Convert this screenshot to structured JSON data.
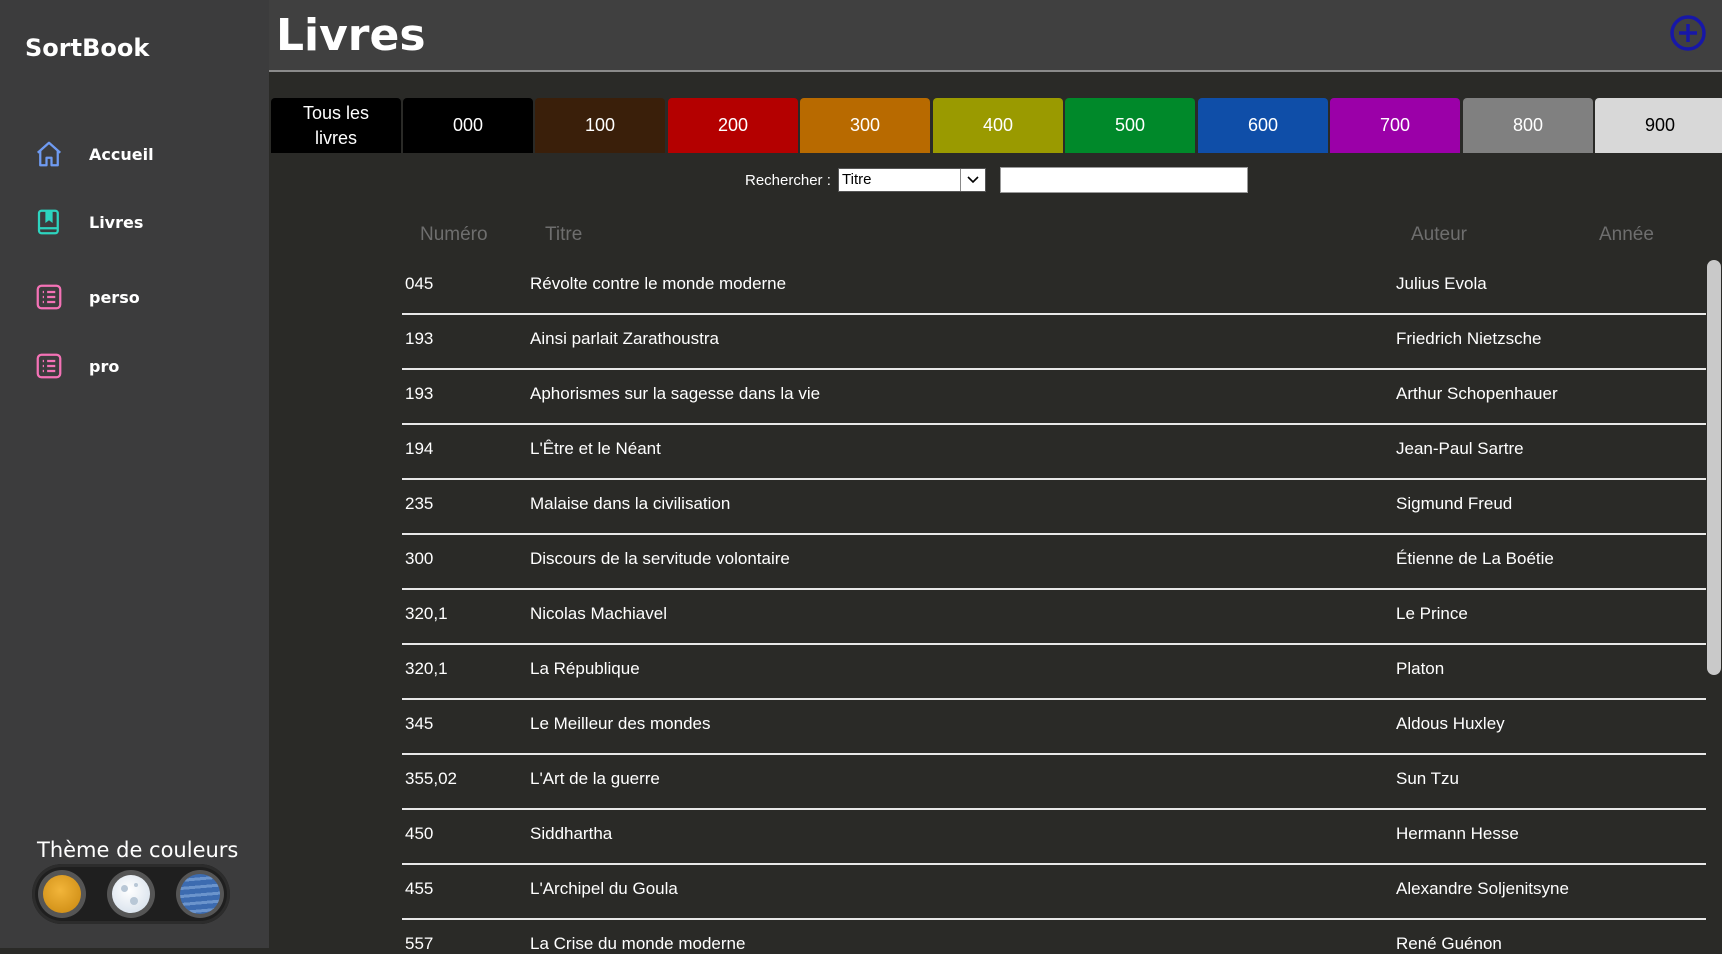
{
  "sidebar": {
    "app_title": "SortBook",
    "items": [
      {
        "label": "Accueil",
        "icon": "home-icon",
        "color": "#6f9bf2"
      },
      {
        "label": "Livres",
        "icon": "book-icon",
        "color": "#2dd4bf"
      },
      {
        "label": "perso",
        "icon": "list-icon",
        "color": "#f472b6"
      },
      {
        "label": "pro",
        "icon": "list-icon",
        "color": "#f472b6"
      }
    ],
    "theme_title": "Thème de couleurs",
    "themes": [
      "sun-icon",
      "moon-icon",
      "planet-icon"
    ]
  },
  "header": {
    "title": "Livres",
    "add_icon": "plus-circle-icon",
    "accent": "#1717a8"
  },
  "tabs": [
    {
      "label": "Tous les livres",
      "bg": "#000000",
      "fg": "#ffffff"
    },
    {
      "label": "000",
      "bg": "#000000",
      "fg": "#ffffff"
    },
    {
      "label": "100",
      "bg": "#3a1f0a",
      "fg": "#ffffff"
    },
    {
      "label": "200",
      "bg": "#b40000",
      "fg": "#ffffff"
    },
    {
      "label": "300",
      "bg": "#b86a00",
      "fg": "#ffffff"
    },
    {
      "label": "400",
      "bg": "#9a9a00",
      "fg": "#ffffff"
    },
    {
      "label": "500",
      "bg": "#00892a",
      "fg": "#ffffff"
    },
    {
      "label": "600",
      "bg": "#0f4ea8",
      "fg": "#ffffff"
    },
    {
      "label": "700",
      "bg": "#9b00a8",
      "fg": "#ffffff"
    },
    {
      "label": "800",
      "bg": "#808080",
      "fg": "#ffffff"
    },
    {
      "label": "900",
      "bg": "#d8d8d8",
      "fg": "#000000"
    }
  ],
  "search": {
    "label": "Rechercher :",
    "field_selected": "Titre",
    "query": ""
  },
  "table": {
    "headers": {
      "numero": "Numéro",
      "titre": "Titre",
      "auteur": "Auteur",
      "annee": "Année"
    },
    "rows": [
      {
        "numero": "045",
        "titre": "Révolte contre le monde moderne",
        "auteur": "Julius Evola"
      },
      {
        "numero": "193",
        "titre": "Ainsi parlait Zarathoustra",
        "auteur": "Friedrich Nietzsche"
      },
      {
        "numero": "193",
        "titre": "Aphorismes sur la sagesse dans la vie",
        "auteur": "Arthur Schopenhauer"
      },
      {
        "numero": "194",
        "titre": "L'Être et le Néant",
        "auteur": "Jean-Paul Sartre"
      },
      {
        "numero": "235",
        "titre": "Malaise dans la civilisation",
        "auteur": "Sigmund Freud"
      },
      {
        "numero": "300",
        "titre": "Discours de la servitude volontaire",
        "auteur": "Étienne de La Boétie"
      },
      {
        "numero": "320,1",
        "titre": "Nicolas Machiavel",
        "auteur": "Le Prince"
      },
      {
        "numero": "320,1",
        "titre": "La République",
        "auteur": "Platon"
      },
      {
        "numero": "345",
        "titre": "Le Meilleur des mondes",
        "auteur": "Aldous Huxley"
      },
      {
        "numero": "355,02",
        "titre": "L'Art de la guerre",
        "auteur": "Sun Tzu"
      },
      {
        "numero": "450",
        "titre": "Siddhartha",
        "auteur": "Hermann Hesse"
      },
      {
        "numero": "455",
        "titre": "L'Archipel du Goula",
        "auteur": "Alexandre Soljenitsyne"
      },
      {
        "numero": "557",
        "titre": "La Crise du monde moderne",
        "auteur": "René Guénon"
      }
    ]
  }
}
